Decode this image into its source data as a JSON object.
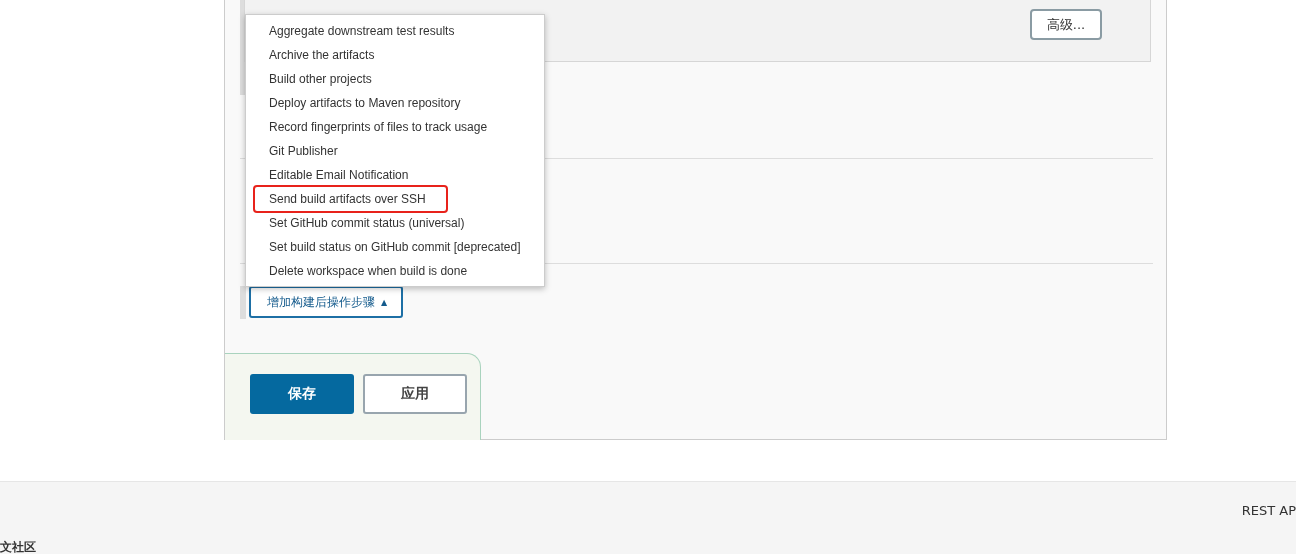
{
  "advanced_button": "高级...",
  "add_step_button": {
    "label": "增加构建后操作步骤",
    "caret": "▲",
    "expanded": true
  },
  "menu": {
    "items": [
      {
        "label": "Aggregate downstream test results",
        "highlighted": false
      },
      {
        "label": "Archive the artifacts",
        "highlighted": false
      },
      {
        "label": "Build other projects",
        "highlighted": false
      },
      {
        "label": "Deploy artifacts to Maven repository",
        "highlighted": false
      },
      {
        "label": "Record fingerprints of files to track usage",
        "highlighted": false
      },
      {
        "label": "Git Publisher",
        "highlighted": false
      },
      {
        "label": "Editable Email Notification",
        "highlighted": false
      },
      {
        "label": "Send build artifacts over SSH",
        "highlighted": true
      },
      {
        "label": "Set GitHub commit status (universal)",
        "highlighted": false
      },
      {
        "label": "Set build status on GitHub commit [deprecated]",
        "highlighted": false
      },
      {
        "label": "Delete workspace when build is done",
        "highlighted": false
      }
    ]
  },
  "buttons": [
    {
      "label": "保存",
      "kind": "primary"
    },
    {
      "label": "应用",
      "kind": "secondary"
    }
  ],
  "footer": {
    "left": "文社区",
    "right": "REST AP"
  }
}
